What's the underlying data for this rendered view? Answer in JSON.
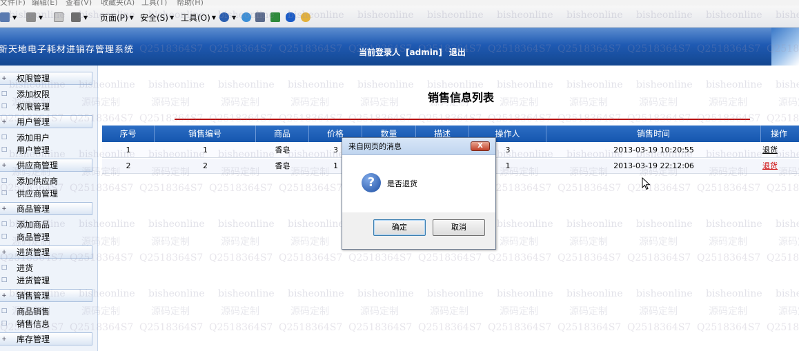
{
  "browser": {
    "menu": [
      "文件(F)",
      "编辑(E)",
      "查看(V)",
      "收藏夹(A)",
      "工具(T)",
      "帮助(H)"
    ],
    "toolbar": {
      "page_label": "页面(P)",
      "safety_label": "安全(S)",
      "tools_label": "工具(O)"
    }
  },
  "header": {
    "system_title": "新天地电子耗材进销存管理系统",
    "login_label": "当前登录人",
    "username": "[admin]",
    "logout_label": "退出"
  },
  "sidebar": {
    "groups": [
      {
        "label": "权限管理",
        "items": [
          "添加权限",
          "权限管理"
        ]
      },
      {
        "label": "用户管理",
        "items": [
          "添加用户",
          "用户管理"
        ]
      },
      {
        "label": "供应商管理",
        "items": [
          "添加供应商",
          "供应商管理"
        ]
      },
      {
        "label": "商品管理",
        "items": [
          "添加商品",
          "商品管理"
        ]
      },
      {
        "label": "进货管理",
        "items": [
          "进货",
          "进货管理"
        ]
      },
      {
        "label": "销售管理",
        "items": [
          "商品销售",
          "销售信息"
        ]
      },
      {
        "label": "库存管理",
        "items": []
      }
    ]
  },
  "main": {
    "page_title": "销售信息列表",
    "columns": [
      "序号",
      "销售编号",
      "商品",
      "价格",
      "数量",
      "描述",
      "操作人",
      "销售时间",
      "操作"
    ],
    "rows": [
      {
        "seq": "1",
        "sale_no": "1",
        "product": "香皂",
        "price": "3",
        "qty": "",
        "desc": "",
        "operator": "3",
        "time": "2013-03-19 10:20:55",
        "action": "退货"
      },
      {
        "seq": "2",
        "sale_no": "2",
        "product": "香皂",
        "price": "1",
        "qty": "",
        "desc": "",
        "operator": "1",
        "time": "2013-03-19 22:12:06",
        "action": "退货"
      }
    ]
  },
  "dialog": {
    "title": "来自网页的消息",
    "message": "是否退货",
    "ok_label": "确定",
    "cancel_label": "取消",
    "close_label": "X"
  },
  "watermark": {
    "en": "bisheonline",
    "qq": "Q2518364S7",
    "cn": "源码定制"
  },
  "colors": {
    "banner": "#1f5ab3",
    "table_header": "#2c6ec4",
    "title_rule": "#b80000",
    "action_active": "#cc0000"
  }
}
